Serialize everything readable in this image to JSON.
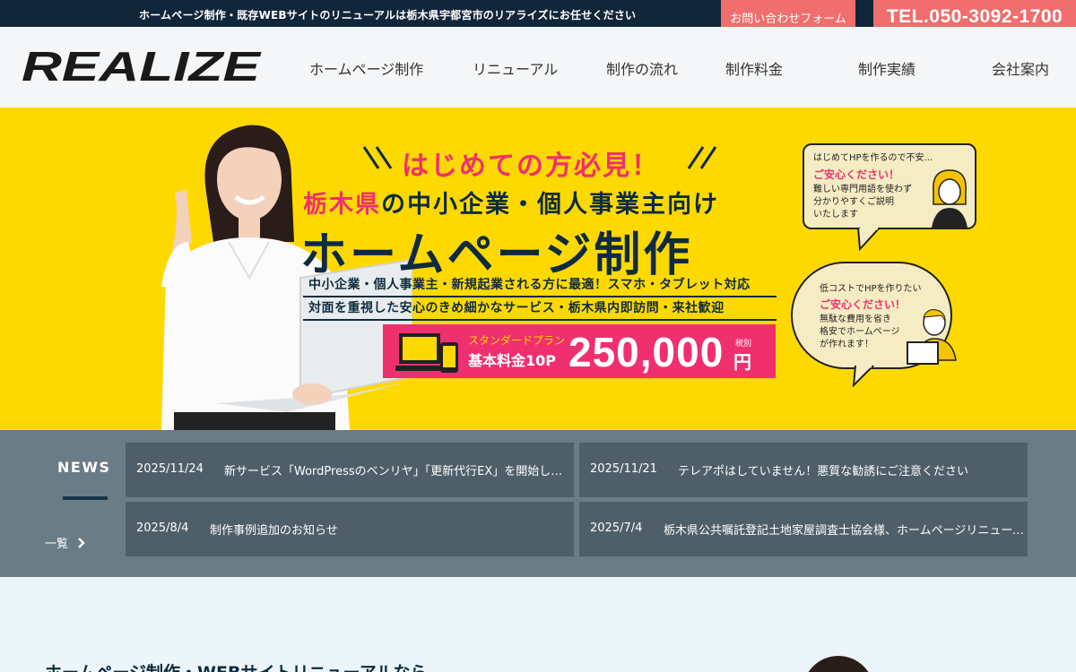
{
  "topbar": {
    "tagline": "ホームページ制作・既存WEBサイトのリニューアルは栃木県宇都宮市のリアライズにお任せください",
    "contact_label": "お問い合わせフォーム",
    "tel_label": "TEL.050-3092-1700"
  },
  "header": {
    "logo_text": "REALIZE",
    "nav": [
      {
        "label": "ホームページ制作"
      },
      {
        "label": "リニューアル"
      },
      {
        "label": "制作の流れ"
      },
      {
        "label": "制作料金"
      },
      {
        "label": "制作実績"
      },
      {
        "label": "会社案内"
      }
    ]
  },
  "hero": {
    "attention": "はじめての方必見！",
    "sub_pink": "栃木県",
    "sub_rest": "の中小企業・個人事業主向け",
    "title": "ホームページ制作",
    "line1": "中小企業・個人事業主・新規起業される方に最適！スマホ・タブレット対応",
    "line2": "対面を重視した安心のきめ細かなサービス・栃木県内即訪問・来社歓迎",
    "price": {
      "plan": "スタンダードプラン",
      "base": "基本料金10P",
      "amount": "250,000",
      "tax": "税別",
      "yen": "円"
    },
    "bubble1": {
      "line1": "はじめてHPを作るので不安...",
      "pink": "ご安心ください！",
      "line2": "難しい専門用語を使わず",
      "line3": "分かりやすくご説明",
      "line4": "いたします"
    },
    "bubble2": {
      "line1": "低コストでHPを作りたい",
      "pink": "ご安心ください！",
      "line2": "無駄な費用を省き",
      "line3": "格安でホームページ",
      "line4": "が作れます！"
    }
  },
  "news": {
    "title": "NEWS",
    "more_label": "一覧",
    "items": [
      {
        "date": "2025/11/24",
        "text": "新サービス「WordPressのベンリヤ」「更新代行EX」を開始しました"
      },
      {
        "date": "2025/11/21",
        "text": "テレアポはしていません！悪質な勧誘にご注意ください"
      },
      {
        "date": "2025/8/4",
        "text": "制作事例追加のお知らせ"
      },
      {
        "date": "2025/7/4",
        "text": "栃木県公共嘱託登記土地家屋調査士協会様、ホームページリニューアル"
      }
    ]
  },
  "section": {
    "heading": "ホームページ制作・WEBサイトリニューアルなら"
  },
  "colors": {
    "topbar": "#12263a",
    "accent_coral": "#f06e6e",
    "hero_yellow": "#fed900",
    "hero_pink": "#f0306e",
    "navy": "#0e2b3e",
    "news_bg": "#6a7c85",
    "news_card": "#4e5f69"
  }
}
